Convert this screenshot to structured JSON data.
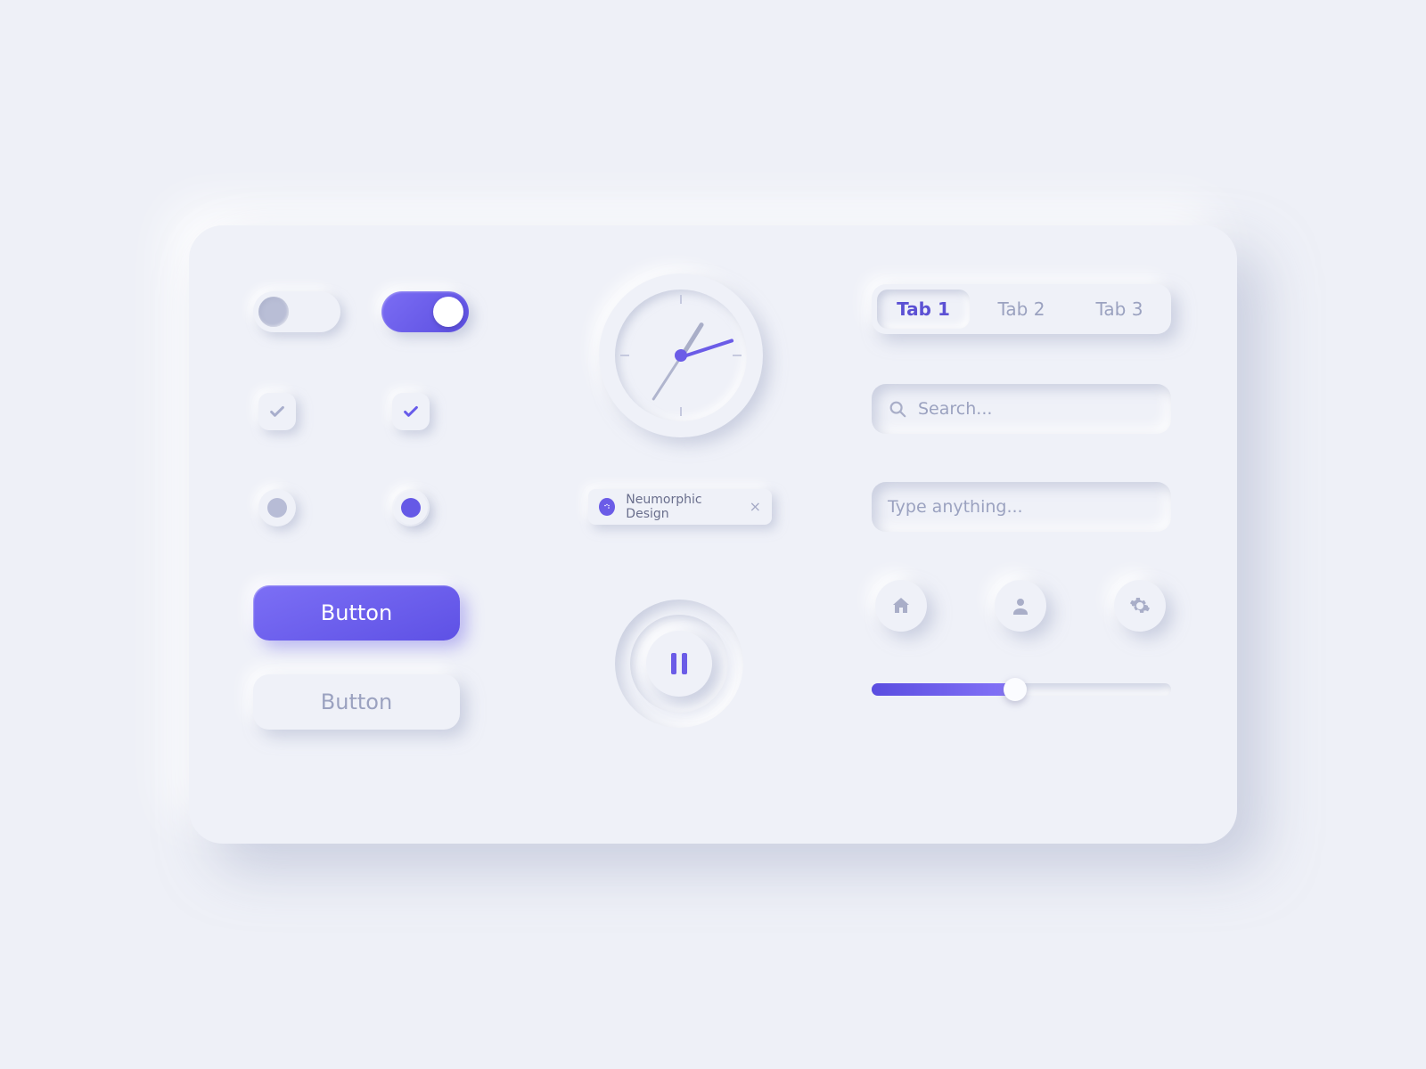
{
  "colors": {
    "accent": "#6b5ce7",
    "muted": "#a9afca",
    "bg": "#eef0f7"
  },
  "toggles": {
    "off_state": false,
    "on_state": true
  },
  "checkboxes": {
    "off_checked": true,
    "on_checked": true
  },
  "radios": {
    "off_selected": false,
    "on_selected": true
  },
  "buttons": {
    "primary_label": "Button",
    "secondary_label": "Button"
  },
  "chip": {
    "icon": "palette",
    "label": "Neumorphic Design",
    "close": "×"
  },
  "clock": {
    "hour_angle": -58,
    "minute_angle": -18,
    "second_angle": 123
  },
  "playback": {
    "state": "paused",
    "icon": "pause"
  },
  "tabs": {
    "items": [
      "Tab 1",
      "Tab 2",
      "Tab 3"
    ],
    "active_index": 0
  },
  "search": {
    "icon": "search",
    "placeholder": "Search..."
  },
  "textinput": {
    "placeholder": "Type anything..."
  },
  "icon_buttons": {
    "items": [
      "home",
      "user",
      "gear"
    ]
  },
  "slider": {
    "value": 48,
    "min": 0,
    "max": 100
  }
}
